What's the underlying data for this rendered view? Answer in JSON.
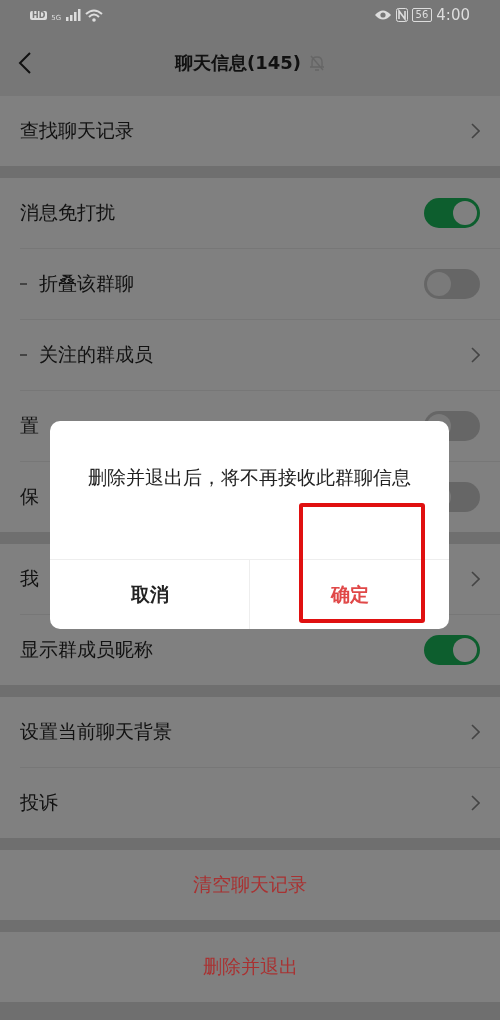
{
  "status_bar": {
    "network_labels": [
      "HD",
      "5G"
    ],
    "battery": "56",
    "time": "4:00"
  },
  "header": {
    "title": "聊天信息(145)",
    "muted": true
  },
  "sections": [
    [
      {
        "label": "查找聊天记录",
        "kind": "link",
        "indented": false
      }
    ],
    [
      {
        "label": "消息免打扰",
        "kind": "toggle",
        "on": true,
        "indented": false
      },
      {
        "label": "折叠该群聊",
        "kind": "toggle",
        "on": false,
        "indented": true
      },
      {
        "label": "关注的群成员",
        "kind": "link",
        "indented": true
      },
      {
        "label": "置",
        "kind": "toggle",
        "on": false,
        "indented": false
      },
      {
        "label": "保",
        "kind": "toggle",
        "on": false,
        "indented": false
      }
    ],
    [
      {
        "label": "我",
        "kind": "link",
        "indented": false
      },
      {
        "label": "显示群成员昵称",
        "kind": "toggle",
        "on": true,
        "indented": false
      }
    ],
    [
      {
        "label": "设置当前聊天背景",
        "kind": "link",
        "indented": false
      },
      {
        "label": "投诉",
        "kind": "link",
        "indented": false
      }
    ],
    [
      {
        "label": "清空聊天记录",
        "kind": "danger",
        "indented": false
      }
    ],
    [
      {
        "label": "删除并退出",
        "kind": "danger",
        "indented": false
      }
    ]
  ],
  "dialog": {
    "message": "删除并退出后，将不再接收此群聊信息",
    "buttons": [
      {
        "label": "取消",
        "kind": "cancel",
        "highlighted": false
      },
      {
        "label": "确定",
        "kind": "confirm",
        "highlighted": true
      }
    ]
  }
}
